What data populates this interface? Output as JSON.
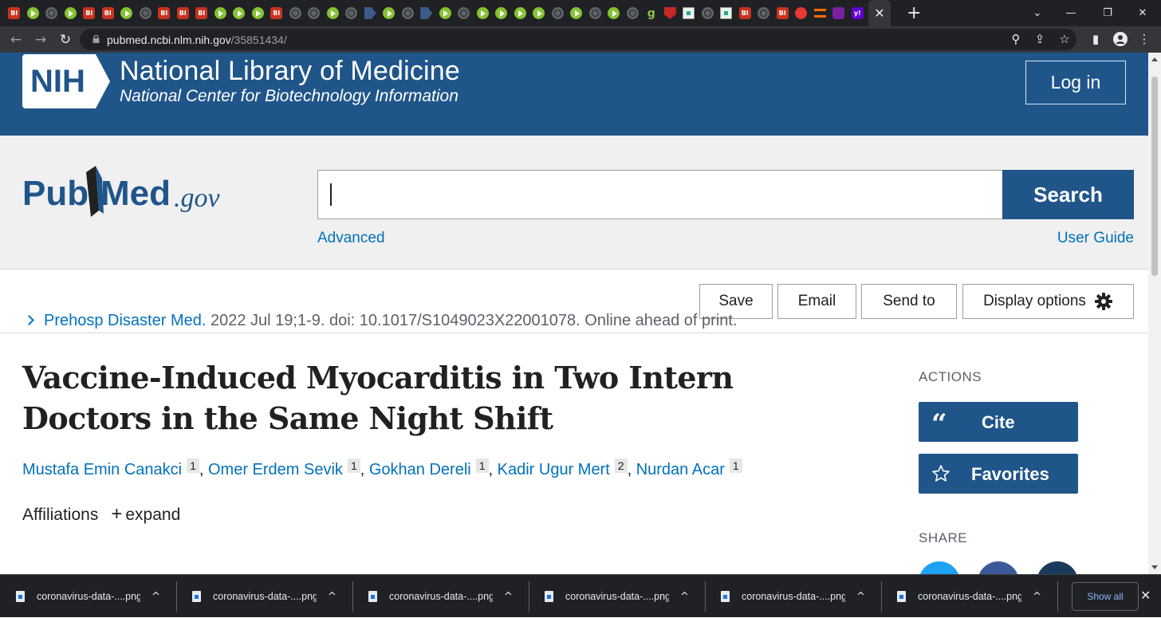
{
  "browser": {
    "tab_icons": [
      "bi",
      "play",
      "globe",
      "play",
      "bi",
      "bi",
      "play",
      "globe",
      "bi",
      "bi",
      "bi",
      "play",
      "play",
      "play",
      "bi",
      "globe",
      "globe",
      "play",
      "globe",
      "dark",
      "play",
      "globe",
      "dark",
      "play",
      "globe",
      "play",
      "play",
      "play",
      "play",
      "globe",
      "play",
      "globe",
      "play",
      "globe",
      "g",
      "shield",
      "check",
      "globe",
      "check",
      "bi",
      "globe",
      "bi",
      "red",
      "stack",
      "mail",
      "yahoo"
    ],
    "close_tab_glyph": "✕",
    "new_tab_glyph": "+",
    "url_host": "pubmed.ncbi.nlm.nih.gov",
    "url_path": "/35851434/"
  },
  "nlm": {
    "logo_text": "NIH",
    "title": "National Library of Medicine",
    "subtitle": "National Center for Biotechnology Information",
    "login_label": "Log in"
  },
  "search": {
    "logo_text_pub": "Pub",
    "logo_text_med": "Med",
    "logo_text_gov": ".gov",
    "value": "",
    "button_label": "Search",
    "advanced_label": "Advanced",
    "user_guide_label": "User Guide"
  },
  "toolbar": {
    "save_label": "Save",
    "email_label": "Email",
    "send_to_label": "Send to",
    "display_options_label": "Display options"
  },
  "article": {
    "journal": "Prehosp Disaster Med.",
    "citation": " 2022 Jul 19;1-9. doi: 10.1017/S1049023X22001078. Online ahead of print.",
    "title": "Vaccine-Induced Myocarditis in Two Intern Doctors in the Same Night Shift",
    "authors": [
      {
        "name": "Mustafa Emin Canakci",
        "aff": "1"
      },
      {
        "name": "Omer Erdem Sevik",
        "aff": "1"
      },
      {
        "name": "Gokhan Dereli",
        "aff": "1"
      },
      {
        "name": "Kadir Ugur Mert",
        "aff": "2"
      },
      {
        "name": "Nurdan Acar",
        "aff": "1"
      }
    ],
    "affiliations_label": "Affiliations",
    "expand_label": "expand"
  },
  "sidebar": {
    "actions_heading": "ACTIONS",
    "cite_label": "Cite",
    "favorites_label": "Favorites",
    "share_heading": "SHARE"
  },
  "downloads": {
    "items": [
      "coronavirus-data-....png",
      "coronavirus-data-....png",
      "coronavirus-data-....png",
      "coronavirus-data-....png",
      "coronavirus-data-....png",
      "coronavirus-data-....png"
    ],
    "show_all_label": "Show all"
  },
  "colors": {
    "nlm_blue": "#20558a",
    "link_blue": "#0071bc",
    "twitter": "#1da1f2",
    "facebook": "#3b5998",
    "dark_share": "#1c3a5c"
  }
}
